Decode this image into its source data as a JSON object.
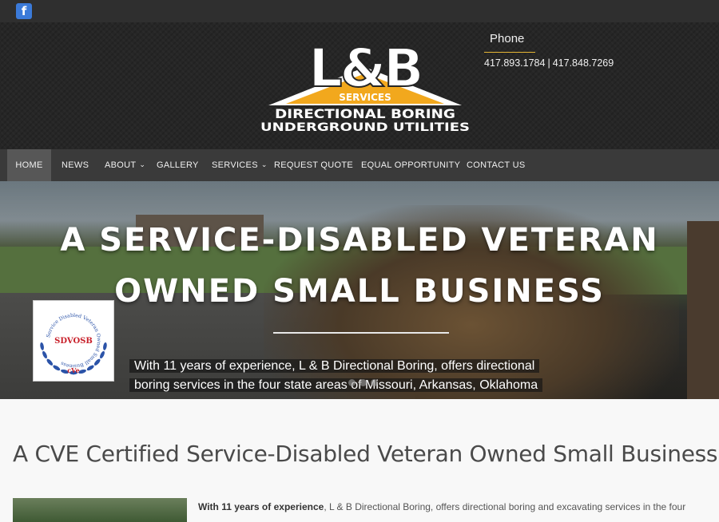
{
  "topbar": {
    "facebook_icon": "facebook-icon",
    "facebook_glyph": "f"
  },
  "header": {
    "logo": {
      "brand": "L&B",
      "services": "SERVICES",
      "line1": "DIRECTIONAL BORING",
      "line2": "UNDERGROUND UTILITIES",
      "accent_color": "#f2a81d"
    },
    "phone_label": "Phone",
    "phone_1": "417.893.1784",
    "phone_sep": "|",
    "phone_2": "417.848.7269"
  },
  "nav": {
    "items": [
      {
        "label": "HOME",
        "active": true
      },
      {
        "label": "NEWS"
      },
      {
        "label": "ABOUT",
        "has_dropdown": true
      },
      {
        "label": "GALLERY"
      },
      {
        "label": "SERVICES",
        "has_dropdown": true
      },
      {
        "label": "REQUEST QUOTE"
      },
      {
        "label": "EQUAL OPPORTUNITY"
      },
      {
        "label": "CONTACT US"
      }
    ],
    "chevron": "⌄"
  },
  "hero": {
    "title_line1": "A SERVICE-DISABLED VETERAN",
    "title_line2": "OWNED SMALL BUSINESS",
    "subtitle": "With 11 years of experience, L & B Directional Boring, offers directional boring services in the four state areas of Missouri, Arkansas, Oklahoma",
    "slide_count": 3,
    "badge": {
      "center_text": "SDVOSB",
      "ring_text": "Service Disabled Veteran Owned Small Business",
      "mark": "cVe",
      "ring_color": "#2b53a8",
      "text_color": "#c8202a"
    }
  },
  "content": {
    "title": "A CVE Certified Service-Disabled Veteran Owned Small Business",
    "para_bold": "With 11 years of experience",
    "para_rest": ", L & B Directional Boring, offers directional boring and excavating services in the four"
  }
}
